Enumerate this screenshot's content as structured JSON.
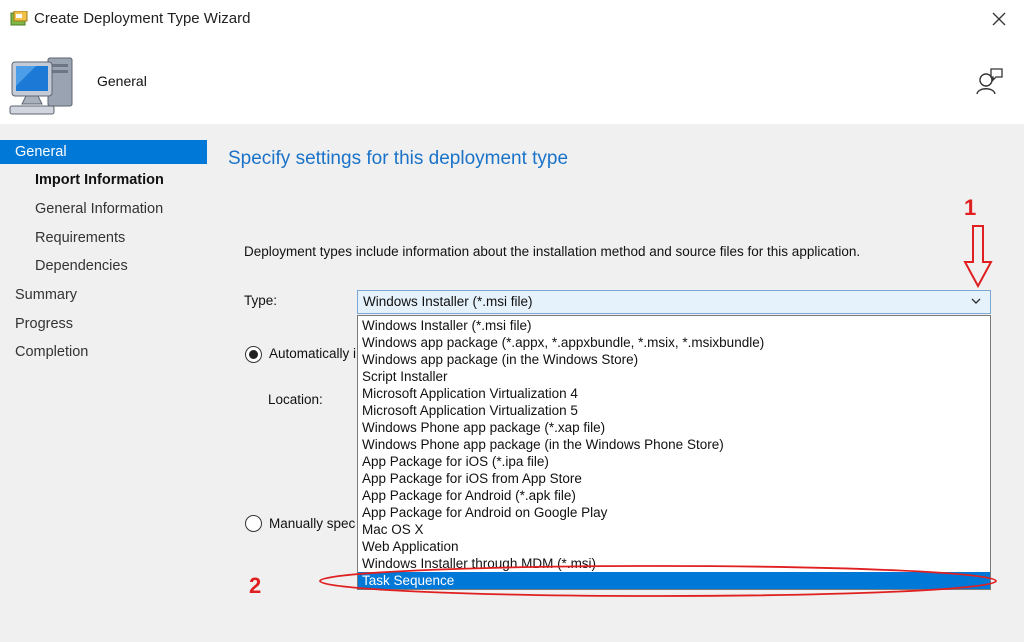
{
  "window": {
    "title": "Create Deployment Type Wizard"
  },
  "header": {
    "title": "General"
  },
  "nav": [
    {
      "label": "General",
      "level": 0,
      "selected": true,
      "bold": false
    },
    {
      "label": "Import Information",
      "level": 1,
      "selected": false,
      "bold": true
    },
    {
      "label": "General Information",
      "level": 1,
      "selected": false,
      "bold": false
    },
    {
      "label": "Requirements",
      "level": 1,
      "selected": false,
      "bold": false
    },
    {
      "label": "Dependencies",
      "level": 1,
      "selected": false,
      "bold": false
    },
    {
      "label": "Summary",
      "level": 0,
      "selected": false,
      "bold": false
    },
    {
      "label": "Progress",
      "level": 0,
      "selected": false,
      "bold": false
    },
    {
      "label": "Completion",
      "level": 0,
      "selected": false,
      "bold": false
    }
  ],
  "main": {
    "section_title": "Specify settings for this deployment type",
    "description": "Deployment types include information about the installation method and source files for this application.",
    "type_label": "Type:",
    "type_value": "Windows Installer (*.msi file)",
    "auto_radio_label": "Automatically i",
    "location_label": "Location:",
    "manual_radio_label": "Manually spec"
  },
  "dropdown": {
    "options": [
      "Windows Installer (*.msi file)",
      "Windows app package (*.appx, *.appxbundle, *.msix, *.msixbundle)",
      "Windows app package (in the Windows Store)",
      "Script Installer",
      "Microsoft Application Virtualization 4",
      "Microsoft Application Virtualization 5",
      "Windows Phone app package (*.xap file)",
      "Windows Phone app package (in the Windows Phone Store)",
      "App Package for iOS (*.ipa file)",
      "App Package for iOS from App Store",
      "App Package for Android (*.apk file)",
      "App Package for Android on Google Play",
      "Mac OS X",
      "Web Application",
      "Windows Installer through MDM (*.msi)",
      "Task Sequence"
    ],
    "selected_index": 15
  },
  "annotations": {
    "marker1": "1",
    "marker2": "2",
    "color": "#e02020"
  },
  "colors": {
    "accent": "#0078d7",
    "title_blue": "#1a73c9"
  }
}
